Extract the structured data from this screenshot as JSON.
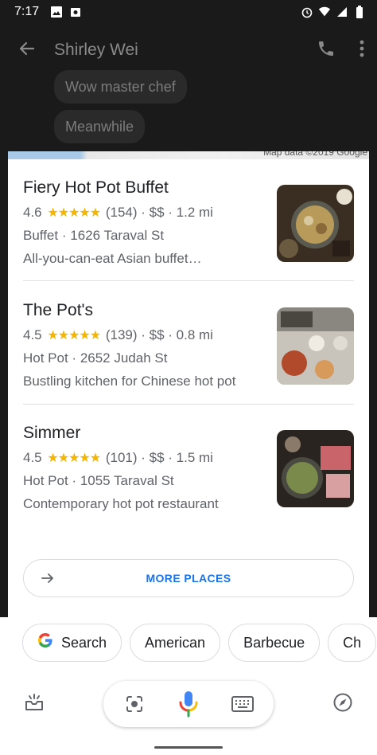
{
  "status_bar": {
    "time": "7:17"
  },
  "chat": {
    "contact_name": "Shirley Wei",
    "bubbles": [
      "Wow master chef",
      "Meanwhile"
    ]
  },
  "map": {
    "credit": "Map data ©2019 Google"
  },
  "places": [
    {
      "name": "Fiery Hot Pot Buffet",
      "rating": "4.6",
      "stars": "★★★★★",
      "reviews": "(154)",
      "price": "$$",
      "distance": "1.2 mi",
      "category": "Buffet",
      "address": "1626 Taraval St",
      "description": "All-you-can-eat Asian buffet…"
    },
    {
      "name": "The Pot's",
      "rating": "4.5",
      "stars": "★★★★★",
      "reviews": "(139)",
      "price": "$$",
      "distance": "0.8 mi",
      "category": "Hot Pot",
      "address": "2652 Judah St",
      "description": "Bustling kitchen for Chinese hot pot"
    },
    {
      "name": "Simmer",
      "rating": "4.5",
      "stars": "★★★★★",
      "reviews": "(101)",
      "price": "$$",
      "distance": "1.5 mi",
      "category": "Hot Pot",
      "address": "1055 Taraval St",
      "description": "Contemporary hot pot restaurant"
    }
  ],
  "more_places_label": "MORE PLACES",
  "chips": [
    "Search",
    "American",
    "Barbecue",
    "Ch"
  ],
  "icons": {
    "back": "arrow-left-icon",
    "call": "phone-icon",
    "menu": "more-vert-icon",
    "updates": "snapshot-tray-icon",
    "lens": "lens-icon",
    "mic": "mic-icon",
    "keyboard": "keyboard-icon",
    "explore": "compass-icon"
  },
  "colors": {
    "accent": "#1a73e8",
    "star": "#f4b400"
  }
}
